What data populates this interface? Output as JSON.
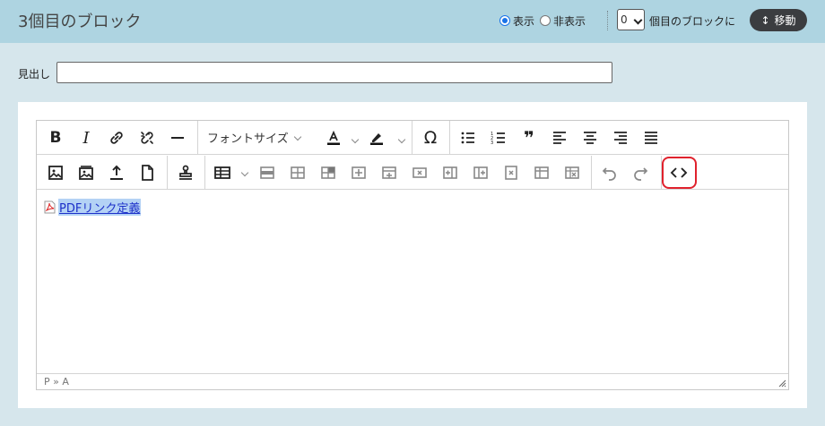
{
  "header": {
    "title": "3個目のブロック",
    "visibility": {
      "options": [
        "表示",
        "非表示"
      ],
      "selected": "表示"
    },
    "position_value": "0",
    "position_suffix": "個目のブロックに",
    "move_button": "移動"
  },
  "heading": {
    "label": "見出し",
    "value": ""
  },
  "toolbar": {
    "row1": [
      "bold-icon",
      "italic-icon",
      "link-icon",
      "unlink-icon",
      "horizontal-rule-icon",
      "font-size",
      "font-color-icon",
      "highlight-icon",
      "omega-icon",
      "bullet-list-icon",
      "numbered-list-icon",
      "blockquote-icon",
      "align-left-icon",
      "align-center-icon",
      "align-right-icon",
      "justify-icon"
    ],
    "font_size_label": "フォントサイズ",
    "row2": [
      "image-icon",
      "gallery-icon",
      "upload-icon",
      "file-icon",
      "stamp-icon",
      "table-icon",
      "table-cell-icons",
      "undo-icon",
      "redo-icon",
      "source-code-icon"
    ]
  },
  "content": {
    "link_text": "PDFリンク定義"
  },
  "statusbar": {
    "path": "P » A"
  },
  "colors": {
    "header_bg": "#aed4e1",
    "page_bg": "#d6e6ec",
    "highlight_ring": "#e0222d",
    "link": "#1d30c9",
    "move_button_bg": "#3b3d40"
  }
}
